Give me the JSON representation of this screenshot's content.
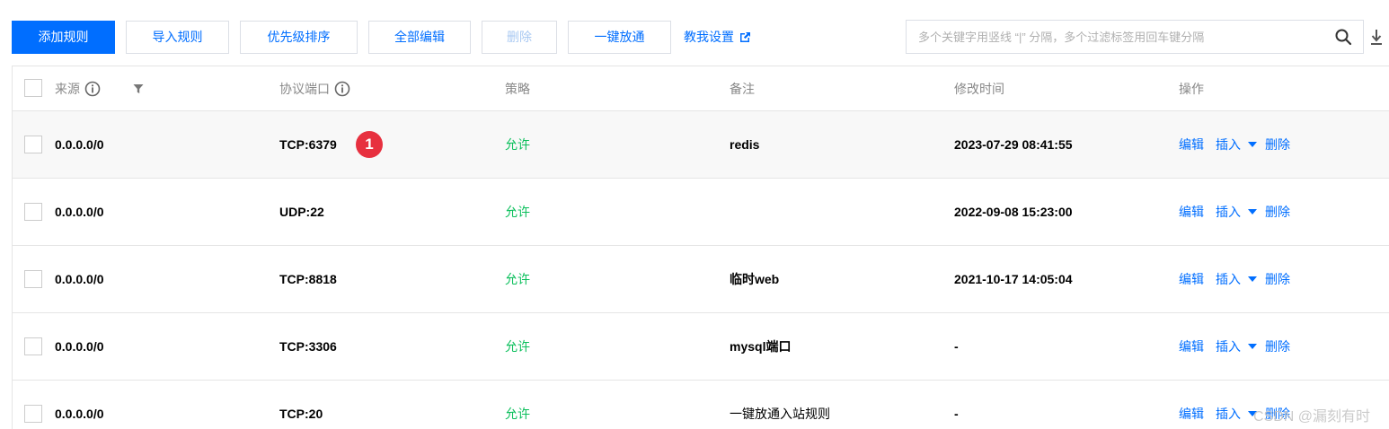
{
  "toolbar": {
    "add_rule": "添加规则",
    "import_rules": "导入规则",
    "priority_sort": "优先级排序",
    "edit_all": "全部编辑",
    "delete": "删除",
    "one_click_allow": "一键放通",
    "teach_me": "教我设置"
  },
  "search": {
    "placeholder": "多个关键字用竖线 “|” 分隔，多个过滤标签用回车键分隔"
  },
  "table": {
    "headers": {
      "source": "来源",
      "protocol_port": "协议端口",
      "policy": "策略",
      "note": "备注",
      "modified_time": "修改时间",
      "operation": "操作"
    },
    "ops": {
      "edit": "编辑",
      "insert": "插入",
      "delete": "删除"
    },
    "rows": [
      {
        "source": "0.0.0.0/0",
        "protocol_port": "TCP:6379",
        "policy": "允许",
        "note": "redis",
        "modified_time": "2023-07-29 08:41:55"
      },
      {
        "source": "0.0.0.0/0",
        "protocol_port": "UDP:22",
        "policy": "允许",
        "note": "",
        "modified_time": "2022-09-08 15:23:00"
      },
      {
        "source": "0.0.0.0/0",
        "protocol_port": "TCP:8818",
        "policy": "允许",
        "note": "临时web",
        "modified_time": "2021-10-17 14:05:04"
      },
      {
        "source": "0.0.0.0/0",
        "protocol_port": "TCP:3306",
        "policy": "允许",
        "note": "mysql端口",
        "modified_time": "-"
      },
      {
        "source": "0.0.0.0/0",
        "protocol_port": "TCP:20",
        "policy": "允许",
        "note": "一键放通入站规则",
        "modified_time": "-"
      }
    ]
  },
  "annotation_badge": "1",
  "watermark": "CSDN @漏刻有时",
  "colors": {
    "primary": "#006eff",
    "allow_green": "#0abf5b",
    "badge_red": "#e7303f"
  },
  "icons": [
    "search-icon",
    "download-icon",
    "external-link-icon",
    "info-icon",
    "filter-icon",
    "caret-down-icon"
  ]
}
